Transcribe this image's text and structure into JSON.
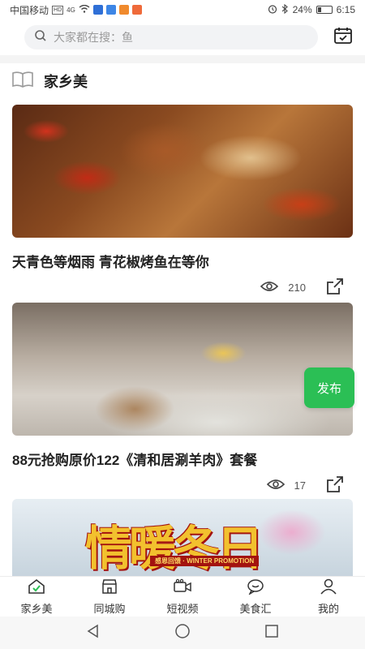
{
  "status_bar": {
    "carrier": "中国移动",
    "network": "4G",
    "battery": "24%",
    "time": "6:15"
  },
  "search": {
    "placeholder": "大家都在搜：鱼"
  },
  "section": {
    "title": "家乡美"
  },
  "feed": {
    "cards": [
      {
        "title": "天青色等烟雨 青花椒烤鱼在等你",
        "views": "210"
      },
      {
        "title": "88元抢购原价122《清和居涮羊肉》套餐",
        "views": "17"
      },
      {
        "title": "",
        "views": "",
        "banner_text": "情暖冬日",
        "banner_sub": "感恩回馈 · WINTER PROMOTION"
      }
    ]
  },
  "publish_button": {
    "label": "发布"
  },
  "tab_bar": {
    "tabs": [
      {
        "label": "家乡美",
        "icon": "home-icon",
        "active": true
      },
      {
        "label": "同城购",
        "icon": "store-icon"
      },
      {
        "label": "短视频",
        "icon": "video-icon"
      },
      {
        "label": "美食汇",
        "icon": "chat-icon"
      },
      {
        "label": "我的",
        "icon": "user-icon"
      }
    ]
  },
  "colors": {
    "accent": "#2bbf55",
    "search_bg": "#f2f3f5"
  }
}
